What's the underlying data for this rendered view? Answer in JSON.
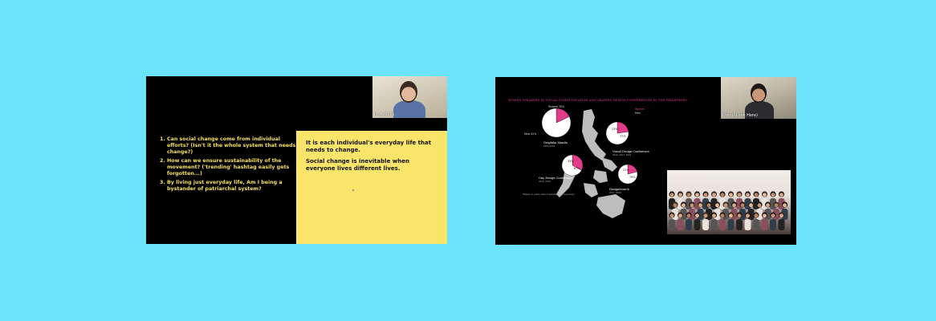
{
  "left_slide": {
    "camera": {
      "name_label": "M-A (CSC)"
    },
    "questions": [
      "Can social change come from individual efforts? (Isn't it the whole system that needs to change?)",
      "How can we ensure sustainability of the movement? ('trending' hashtag easily gets forgotten...)",
      "By living just everyday life, Am I being a bystander of patriarchal system?"
    ],
    "answer": {
      "line1": "It is each individual's everyday life that needs to change.",
      "line2": "Social change is inevitable when everyone lives different lives."
    }
  },
  "right_slide": {
    "camera": {
      "name_label": "Dang (Look Here)"
    },
    "chart_title": "WOMEN SPEAKERS IN VISUAL COMMUNICATION AND GRAPHIC DESIGN CONFERENCES IN THE PHILIPPINES",
    "legend": {
      "women_label": "Women",
      "men_label": "Men"
    },
    "chart_data": [
      {
        "type": "pie",
        "name": "Graphika Manila",
        "years": "2009-2019",
        "values": [
          {
            "label": "Men",
            "value": 82
          },
          {
            "label": "Women",
            "value": 18
          }
        ],
        "text_labels": [
          "Women 18%",
          "Men 82%"
        ]
      },
      {
        "type": "pie",
        "name": "Visual Design Conference",
        "years": "2016, 2017, 2018",
        "values": [
          {
            "label": "Men",
            "value": 77
          },
          {
            "label": "Women",
            "value": 23
          }
        ],
        "text_labels": [
          "23%",
          "77%"
        ]
      },
      {
        "type": "pie",
        "name": "Ono Design Conference",
        "years": "2018, 2019",
        "values": [
          {
            "label": "Men",
            "value": 67
          },
          {
            "label": "Women",
            "value": 33
          }
        ],
        "text_labels": [
          "33%",
          "67%"
        ]
      },
      {
        "type": "pie",
        "name": "DesignSearch",
        "years": "2017, 2018",
        "values": [
          {
            "label": "Men",
            "value": 79
          },
          {
            "label": "Women",
            "value": 21
          }
        ],
        "text_labels": [
          "21%",
          "79%"
        ]
      }
    ],
    "footnote": "*Based on public data of speakers and organizers",
    "colors": {
      "women": "#e23b8a",
      "men": "#ffffff",
      "map": "#bdbdbd",
      "panel_yellow": "#fbe46a",
      "text_yellow": "#f4e05a",
      "background": "#6ae3fb"
    }
  }
}
